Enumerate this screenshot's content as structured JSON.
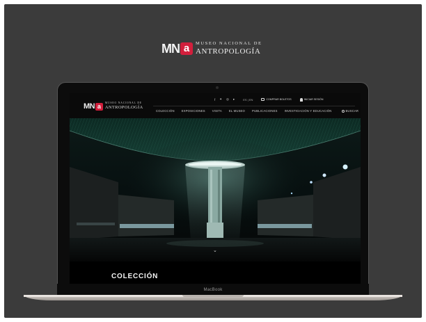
{
  "brand": {
    "logo_mark": "MN",
    "logo_accent": "a",
    "name_line1": "MUSEO NACIONAL DE",
    "name_line2": "ANTROPOLOGÍA",
    "accent_color": "#d21f3c"
  },
  "site": {
    "header": {
      "logo_mark": "MN",
      "logo_accent": "a",
      "name_line1": "MUSEO NACIONAL DE",
      "name_line2": "ANTROPOLOGÍA",
      "social_icons": [
        "facebook-icon",
        "twitter-icon",
        "instagram-icon",
        "youtube-icon"
      ],
      "language": "ES | EN",
      "buy_tickets": "COMPRAR BOLETOS",
      "login": "INICIAR SESIÓN",
      "nav": [
        "COLECCIÓN",
        "EXPOSICIONES",
        "VISITA",
        "EL MUSEO",
        "PUBLICACIONES",
        "INVESTIGACIÓN Y EDUCACIÓN"
      ],
      "search": "BUSCAR"
    },
    "section_title": "COLECCIÓN"
  },
  "device": {
    "label": "MacBook"
  }
}
